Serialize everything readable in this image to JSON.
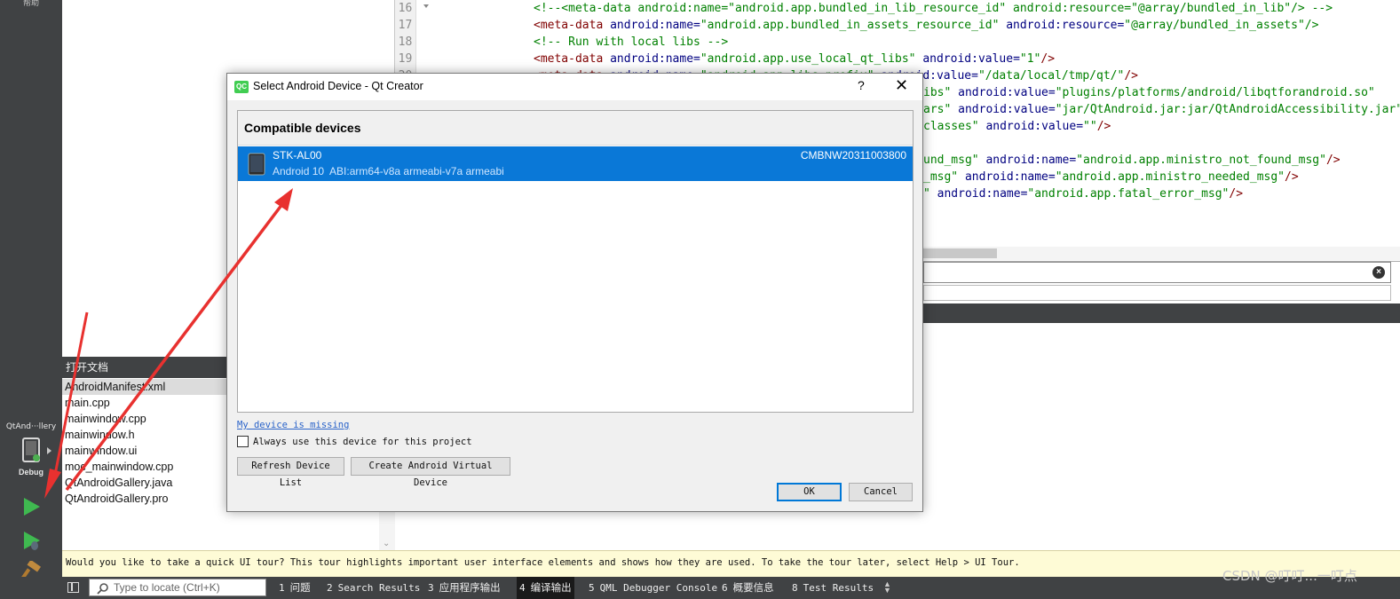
{
  "modebar": {
    "help_label": "帮助",
    "kit_name": "QtAnd···llery",
    "kit_mode": "Debug"
  },
  "open_documents": {
    "header": "打开文档",
    "items": [
      "AndroidManifest.xml",
      "main.cpp",
      "mainwindow.cpp",
      "mainwindow.h",
      "mainwindow.ui",
      "moc_mainwindow.cpp",
      "QtAndroidGallery.java",
      "QtAndroidGallery.pro"
    ],
    "selected_index": 0
  },
  "editor": {
    "line_numbers": [
      "16",
      "17",
      "18",
      "19",
      "20"
    ],
    "lines": [
      {
        "indent": "    ",
        "segments": [
          [
            "cm",
            "<!--<meta-data android:name=\"android.app.bundled_in_lib_resource_id\" android:resource=\"@array/bundled_in_lib\"/> -->"
          ]
        ]
      },
      {
        "indent": "    ",
        "segments": [
          [
            "tag",
            "<meta-data"
          ],
          [
            "attr",
            " android:name="
          ],
          [
            "str",
            "\"android.app.bundled_in_assets_resource_id\""
          ],
          [
            "attr",
            " android:resource="
          ],
          [
            "str",
            "\"@array/bundled_in_assets\"/>"
          ]
        ]
      },
      {
        "indent": "    ",
        "segments": [
          [
            "cm",
            "<!-- Run with local libs -->"
          ]
        ]
      },
      {
        "indent": "    ",
        "segments": [
          [
            "tag",
            "<meta-data"
          ],
          [
            "attr",
            " android:name="
          ],
          [
            "str",
            "\"android.app.use_local_qt_libs\""
          ],
          [
            "attr",
            " android:value="
          ],
          [
            "str",
            "\"1\""
          ],
          [
            "tag",
            "/>"
          ]
        ]
      },
      {
        "indent": "    ",
        "segments": [
          [
            "tag",
            "<meta-data"
          ],
          [
            "attr",
            " android:name="
          ],
          [
            "str",
            "\"android.app.libs_prefix\""
          ],
          [
            "attr",
            " android:value="
          ],
          [
            "str",
            "\"/data/local/tmp/qt/\""
          ],
          [
            "tag",
            "/>"
          ]
        ]
      }
    ],
    "visible_right_fragments": [
      {
        "segments": [
          [
            "str",
            "ibs\""
          ],
          [
            "attr",
            " android:value="
          ],
          [
            "str",
            "\"plugins/platforms/android/libqtforandroid.so\""
          ]
        ]
      },
      {
        "segments": [
          [
            "str",
            "ars\""
          ],
          [
            "attr",
            " android:value="
          ],
          [
            "str",
            "\"jar/QtAndroid.jar:jar/QtAndroidAccessibility.jar\""
          ]
        ]
      },
      {
        "segments": [
          [
            "str",
            "classes\""
          ],
          [
            "attr",
            " android:value="
          ],
          [
            "str",
            "\"\""
          ],
          [
            "tag",
            "/>"
          ]
        ]
      },
      {
        "segments": []
      },
      {
        "segments": [
          [
            "str",
            "und_msg\""
          ],
          [
            "attr",
            " android:name="
          ],
          [
            "str",
            "\"android.app.ministro_not_found_msg\""
          ],
          [
            "tag",
            "/>"
          ]
        ]
      },
      {
        "segments": [
          [
            "str",
            "_msg\""
          ],
          [
            "attr",
            " android:name="
          ],
          [
            "str",
            "\"android.app.ministro_needed_msg\""
          ],
          [
            "tag",
            "/>"
          ]
        ]
      },
      {
        "segments": [
          [
            "str",
            "\""
          ],
          [
            "attr",
            " android:name="
          ],
          [
            "str",
            "\"android.app.fatal_error_msg\""
          ],
          [
            "tag",
            "/>"
          ]
        ]
      }
    ]
  },
  "dialog": {
    "title": "Select Android Device - Qt Creator",
    "logo_text": "QC",
    "help_glyph": "?",
    "close_glyph": "✕",
    "devices_header": "Compatible devices",
    "device": {
      "name": "STK-AL00",
      "serial": "CMBNW20311003800",
      "info": "Android 10  ABI:arm64-v8a armeabi-v7a armeabi"
    },
    "missing_link": "My device is missing",
    "always_use_label": "Always use this device for this project",
    "always_use_checked": false,
    "refresh_button": "Refresh Device List",
    "create_avd_button": "Create Android Virtual Device",
    "ok_button": "OK",
    "cancel_button": "Cancel"
  },
  "tour_bar": {
    "message": "Would you like to take a quick UI tour? This tour highlights important user interface elements and shows how they are used. To take the tour later, select Help > UI Tour."
  },
  "status_bar": {
    "locator_placeholder": "Type to locate (Ctrl+K)",
    "tabs": [
      {
        "num": "1",
        "label": "问题",
        "mono": false
      },
      {
        "num": "2",
        "label": "Search Results",
        "mono": true
      },
      {
        "num": "3",
        "label": "应用程序输出",
        "mono": false
      },
      {
        "num": "4",
        "label": "编译输出",
        "mono": false,
        "active": true
      },
      {
        "num": "5",
        "label": "QML Debugger Console",
        "mono": true
      },
      {
        "num": "6",
        "label": "概要信息",
        "mono": false
      },
      {
        "num": "8",
        "label": "Test Results",
        "mono": true
      }
    ]
  },
  "watermark": "CSDN @叮叮...一叮点",
  "colors": {
    "selection_blue": "#0a78d7",
    "annotation_red": "#e8312f",
    "sidebar_dark": "#404244",
    "tour_bar_bg": "#fefbd6"
  }
}
